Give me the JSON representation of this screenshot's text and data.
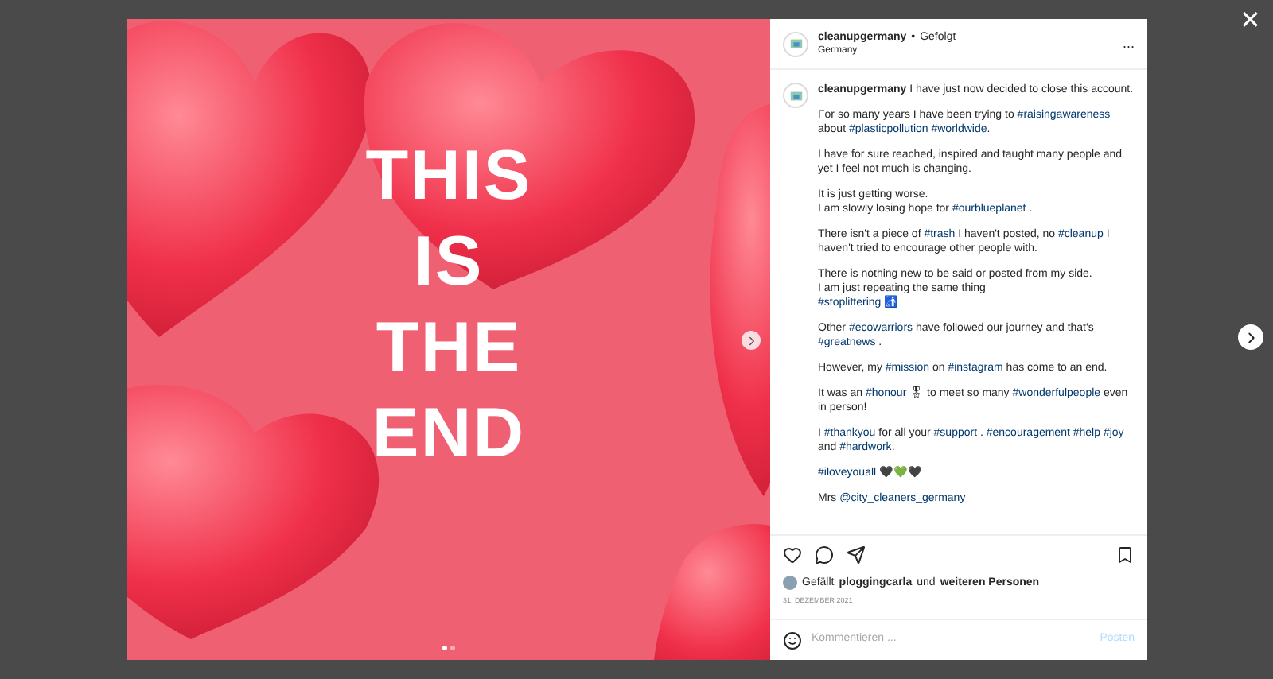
{
  "post_image": {
    "text_lines": [
      "THIS",
      "IS",
      "THE",
      "END"
    ],
    "dots": [
      {
        "selected": true
      },
      {
        "selected": false
      }
    ]
  },
  "header": {
    "username": "cleanupgermany",
    "separator": "•",
    "follow_status": "Gefolgt",
    "location": "Germany",
    "more": "..."
  },
  "caption": {
    "username": "cleanupgermany",
    "paragraphs": [
      [
        [
          {
            "kind": "text",
            "text": "I have just now decided to close this account."
          }
        ]
      ],
      [
        [
          {
            "kind": "text",
            "text": "For so many years I have been trying to "
          },
          {
            "kind": "tag",
            "text": "#raisingawareness"
          },
          {
            "kind": "text",
            "text": " about "
          },
          {
            "kind": "tag",
            "text": "#plasticpollution"
          },
          {
            "kind": "tag",
            "text": "#worldwide"
          },
          {
            "kind": "text",
            "text": "."
          }
        ]
      ],
      [
        [
          {
            "kind": "text",
            "text": "I have for sure reached, inspired and taught many people and yet I feel not much is changing."
          }
        ]
      ],
      [
        [
          {
            "kind": "text",
            "text": "It is just getting worse."
          }
        ],
        [
          {
            "kind": "text",
            "text": "I am slowly losing hope for "
          },
          {
            "kind": "tag",
            "text": "#ourblueplanet"
          },
          {
            "kind": "text",
            "text": " ."
          }
        ]
      ],
      [
        [
          {
            "kind": "text",
            "text": "There isn't a piece of "
          },
          {
            "kind": "tag",
            "text": "#trash"
          },
          {
            "kind": "text",
            "text": " I haven't posted, no "
          },
          {
            "kind": "tag",
            "text": "#cleanup"
          },
          {
            "kind": "text",
            "text": " I haven't tried to encourage other people with."
          }
        ]
      ],
      [
        [
          {
            "kind": "text",
            "text": "There is nothing new to be said or posted from my side."
          }
        ],
        [
          {
            "kind": "text",
            "text": "I am just repeating the same thing"
          }
        ],
        [
          {
            "kind": "tag",
            "text": "#stoplittering"
          },
          {
            "kind": "text",
            "text": " 🚮"
          }
        ]
      ],
      [
        [
          {
            "kind": "text",
            "text": "Other "
          },
          {
            "kind": "tag",
            "text": "#ecowarriors"
          },
          {
            "kind": "text",
            "text": " have followed our journey and that's "
          },
          {
            "kind": "tag",
            "text": "#greatnews"
          },
          {
            "kind": "text",
            "text": " ."
          }
        ]
      ],
      [
        [
          {
            "kind": "text",
            "text": "However, my "
          },
          {
            "kind": "tag",
            "text": "#mission"
          },
          {
            "kind": "text",
            "text": " on "
          },
          {
            "kind": "tag",
            "text": "#instagram"
          },
          {
            "kind": "text",
            "text": " has come to an end."
          }
        ]
      ],
      [
        [
          {
            "kind": "text",
            "text": "It was an "
          },
          {
            "kind": "tag",
            "text": "#honour"
          },
          {
            "kind": "text",
            "text": " 🎖 to meet so many "
          },
          {
            "kind": "tag",
            "text": "#wonderfulpeople"
          },
          {
            "kind": "text",
            "text": " even in person!"
          }
        ]
      ],
      [
        [
          {
            "kind": "text",
            "text": "I "
          },
          {
            "kind": "tag",
            "text": "#thankyou"
          },
          {
            "kind": "text",
            "text": " for all your "
          },
          {
            "kind": "tag",
            "text": "#support"
          },
          {
            "kind": "text",
            "text": " . "
          },
          {
            "kind": "tag",
            "text": "#encouragement"
          },
          {
            "kind": "tag",
            "text": "#help"
          },
          {
            "kind": "tag",
            "text": "#joy"
          },
          {
            "kind": "text",
            "text": " and "
          },
          {
            "kind": "tag",
            "text": "#hardwork"
          },
          {
            "kind": "text",
            "text": "."
          }
        ]
      ],
      [
        [
          {
            "kind": "tag",
            "text": "#iloveyouall"
          },
          {
            "kind": "text",
            "text": " 🖤💚🖤"
          }
        ]
      ],
      [
        [
          {
            "kind": "text",
            "text": "Mrs "
          },
          {
            "kind": "tag",
            "text": "@city_cleaners_germany"
          }
        ]
      ]
    ]
  },
  "likes": {
    "prefix": "Gefällt",
    "user": "ploggingcarla",
    "middle": "und",
    "others": "weiteren Personen"
  },
  "date": "31. DEZEMBER 2021",
  "comment": {
    "placeholder": "Kommentieren ...",
    "post_button": "Posten"
  },
  "close": "✕"
}
